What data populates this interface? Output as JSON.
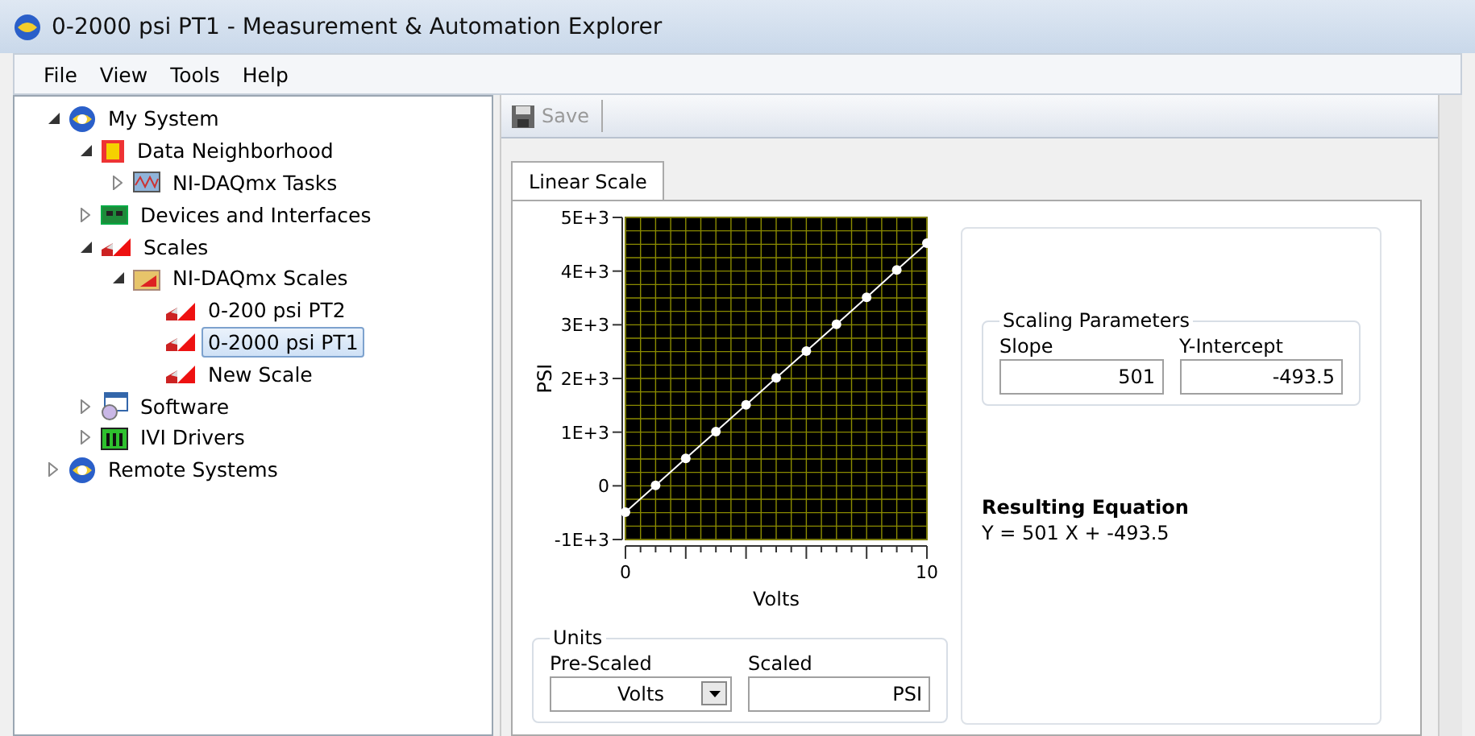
{
  "window": {
    "title": "0-2000 psi PT1 - Measurement & Automation Explorer"
  },
  "menu": [
    "File",
    "View",
    "Tools",
    "Help"
  ],
  "tree": [
    {
      "label": "My System",
      "kind": "globe",
      "expanded": true,
      "selected": false,
      "children": [
        {
          "label": "Data Neighborhood",
          "kind": "data",
          "expanded": true,
          "selected": false,
          "children": [
            {
              "label": "NI-DAQmx Tasks",
              "kind": "tasks",
              "expanded": false,
              "selected": false
            }
          ]
        },
        {
          "label": "Devices and Interfaces",
          "kind": "board",
          "expanded": false,
          "selected": false
        },
        {
          "label": "Scales",
          "kind": "scale",
          "expanded": true,
          "selected": false,
          "children": [
            {
              "label": "NI-DAQmx Scales",
              "kind": "folder",
              "expanded": true,
              "selected": false,
              "children": [
                {
                  "label": "0-200 psi PT2",
                  "kind": "scale",
                  "selected": false
                },
                {
                  "label": "0-2000 psi PT1",
                  "kind": "scale",
                  "selected": true
                },
                {
                  "label": "New Scale",
                  "kind": "scale",
                  "selected": false
                }
              ]
            }
          ]
        },
        {
          "label": "Software",
          "kind": "software",
          "expanded": false,
          "selected": false
        },
        {
          "label": "IVI Drivers",
          "kind": "ivi",
          "expanded": false,
          "selected": false
        }
      ]
    },
    {
      "label": "Remote Systems",
      "kind": "globe",
      "expanded": false,
      "selected": false
    }
  ],
  "toolbar": {
    "save": {
      "label": "Save",
      "disabled": true
    }
  },
  "tabs": [
    {
      "label": "Linear Scale",
      "selected": true
    }
  ],
  "chart": {
    "chart_data": {
      "type": "line",
      "xlabel": "Volts",
      "ylabel": "PSI",
      "grid": true,
      "x": [
        0,
        1,
        2,
        3,
        4,
        5,
        6,
        7,
        8,
        9,
        10
      ],
      "series": [
        {
          "color": "#ffffff",
          "marker": "circle",
          "values": [
            -490,
            10,
            510,
            1010,
            1510,
            2010,
            2510,
            3010,
            3510,
            4020,
            4520
          ]
        }
      ],
      "xlim": [
        0,
        10
      ],
      "ylim": [
        -1000,
        5000
      ],
      "xticks": [
        0,
        10
      ],
      "yticks": [
        {
          "value": 5000,
          "label": "5E+3"
        },
        {
          "value": 4000,
          "label": "4E+3"
        },
        {
          "value": 3000,
          "label": "3E+3"
        },
        {
          "value": 2000,
          "label": "2E+3"
        },
        {
          "value": 1000,
          "label": "1E+3"
        },
        {
          "value": 0,
          "label": "0"
        },
        {
          "value": -1000,
          "label": "-1E+3"
        }
      ]
    }
  },
  "units": {
    "title": "Units",
    "pre_scaled": {
      "label": "Pre-Scaled",
      "value": "Volts"
    },
    "scaled": {
      "label": "Scaled",
      "value": "PSI"
    }
  },
  "scaling_parameters": {
    "title": "Scaling Parameters",
    "slope": {
      "label": "Slope",
      "value": "501"
    },
    "intercept": {
      "label": "Y-Intercept",
      "value": "-493.5"
    }
  },
  "equation": {
    "title": "Resulting Equation",
    "text": "Y = 501 X + -493.5"
  }
}
